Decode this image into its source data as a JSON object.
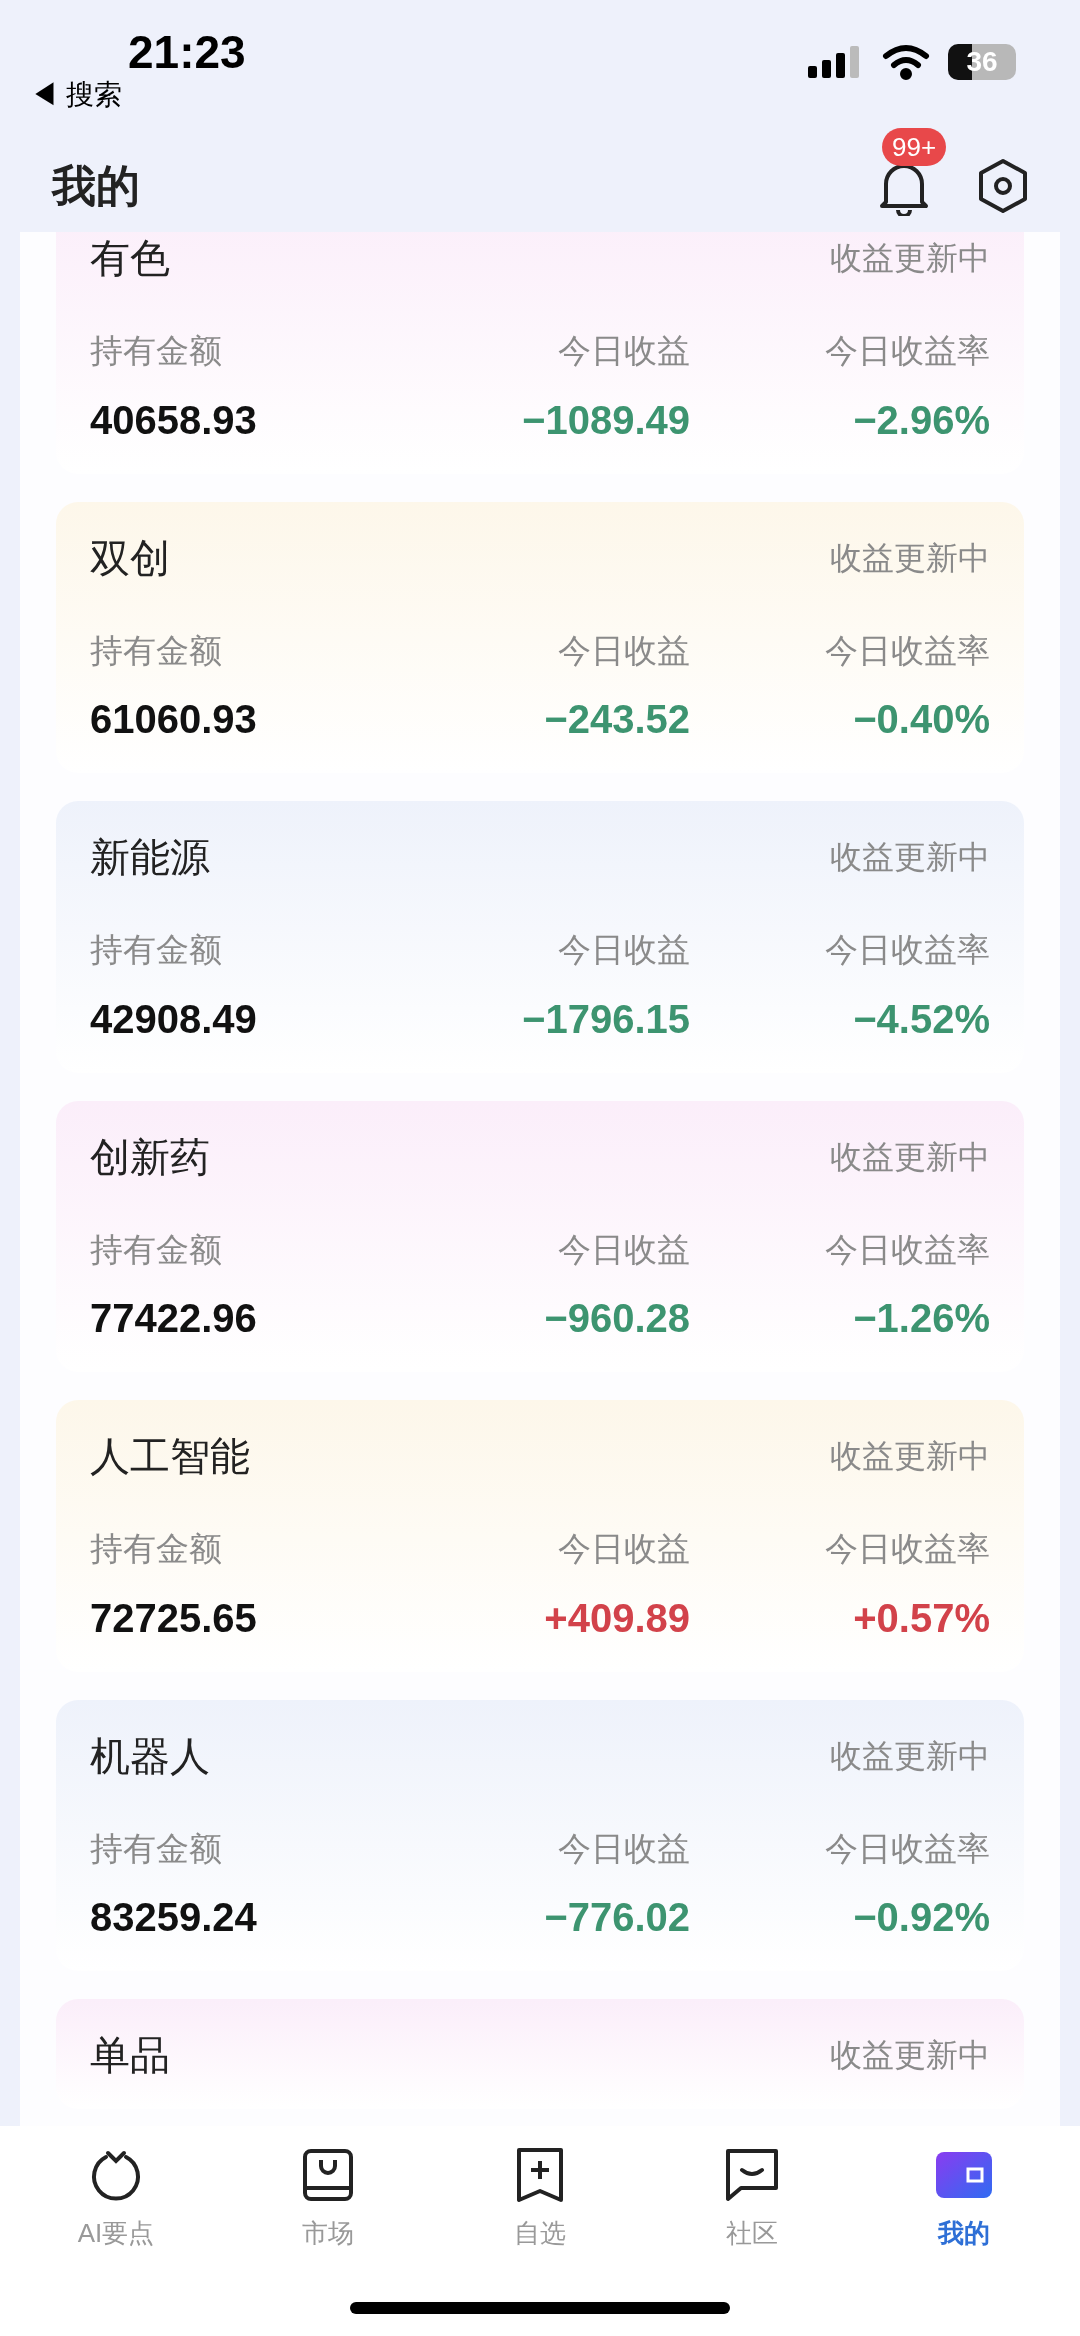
{
  "status_bar": {
    "time": "21:23",
    "back_label": "◀ 搜索",
    "battery": "36"
  },
  "header": {
    "title": "我的",
    "notification_badge": "99+"
  },
  "cards": [
    {
      "name": "有色",
      "status": "收益更新中",
      "color": "#fbeefa",
      "labels": [
        "持有金额",
        "今日收益",
        "今日收益率"
      ],
      "holding": "40658.93",
      "change": {
        "gain": "−1089.49",
        "rate": "−2.96%",
        "color": "#3d9470"
      }
    },
    {
      "name": "双创",
      "status": "收益更新中",
      "color": "#fdf7ea",
      "labels": [
        "持有金额",
        "今日收益",
        "今日收益率"
      ],
      "holding": "61060.93",
      "change": {
        "gain": "−243.52",
        "rate": "−0.40%",
        "color": "#3d9470"
      }
    },
    {
      "name": "新能源",
      "status": "收益更新中",
      "color": "#eef2fb",
      "labels": [
        "持有金额",
        "今日收益",
        "今日收益率"
      ],
      "holding": "42908.49",
      "change": {
        "gain": "−1796.15",
        "rate": "−4.52%",
        "color": "#3d9470"
      }
    },
    {
      "name": "创新药",
      "status": "收益更新中",
      "color": "#fbeefa",
      "labels": [
        "持有金额",
        "今日收益",
        "今日收益率"
      ],
      "holding": "77422.96",
      "change": {
        "gain": "−960.28",
        "rate": "−1.26%",
        "color": "#3d9470"
      }
    },
    {
      "name": "人工智能",
      "status": "收益更新中",
      "color": "#fdf7ea",
      "labels": [
        "持有金额",
        "今日收益",
        "今日收益率"
      ],
      "holding": "72725.65",
      "change": {
        "gain": "+409.89",
        "rate": "+0.57%",
        "color": "#d2424a"
      }
    },
    {
      "name": "机器人",
      "status": "收益更新中",
      "color": "#eef2fb",
      "labels": [
        "持有金额",
        "今日收益",
        "今日收益率"
      ],
      "holding": "83259.24",
      "change": {
        "gain": "−776.02",
        "rate": "−0.92%",
        "color": "#3d9470"
      }
    },
    {
      "name": "单品",
      "status": "收益更新中",
      "color": "#fbeefa"
    }
  ],
  "tab_bar": [
    {
      "label": "AI要点",
      "kind": "ai",
      "selected": false
    },
    {
      "label": "市场",
      "kind": "market",
      "selected": false
    },
    {
      "label": "自选",
      "kind": "watchlist",
      "selected": false
    },
    {
      "label": "社区",
      "kind": "community",
      "selected": false
    },
    {
      "label": "我的",
      "kind": "mine",
      "selected": true
    }
  ]
}
